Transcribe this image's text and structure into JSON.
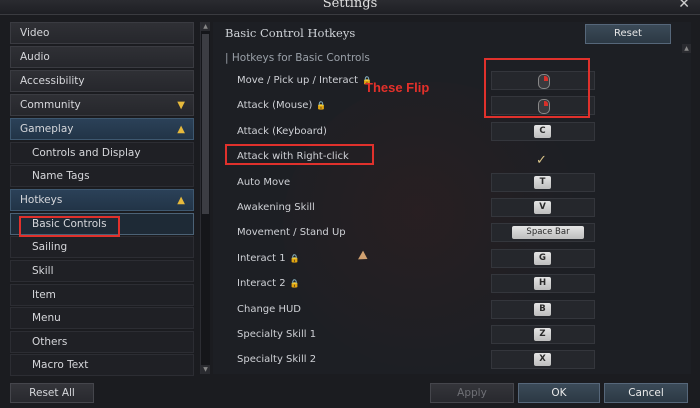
{
  "window": {
    "title": "Settings",
    "close_glyph": "✕"
  },
  "sidebar": {
    "items": [
      {
        "label": "Video"
      },
      {
        "label": "Audio"
      },
      {
        "label": "Accessibility"
      },
      {
        "label": "Community"
      },
      {
        "label": "Gameplay"
      },
      {
        "label": "Controls and Display"
      },
      {
        "label": "Name Tags"
      },
      {
        "label": "Hotkeys"
      },
      {
        "label": "Basic Controls"
      },
      {
        "label": "Sailing"
      },
      {
        "label": "Skill"
      },
      {
        "label": "Item"
      },
      {
        "label": "Menu"
      },
      {
        "label": "Others"
      },
      {
        "label": "Macro Text"
      }
    ],
    "selected": "Basic Controls"
  },
  "panel": {
    "title": "Basic Control Hotkeys",
    "reset_label": "Reset",
    "section_title": "| Hotkeys for Basic Controls",
    "rows": [
      {
        "label": "Move / Pick up / Interact",
        "locked": true,
        "key": "mouse-right-icon"
      },
      {
        "label": "Attack (Mouse)",
        "locked": true,
        "key": "mouse-right-icon"
      },
      {
        "label": "Attack (Keyboard)",
        "locked": false,
        "key": "C"
      },
      {
        "label": "Attack with Right-click",
        "locked": false,
        "key": "✓"
      },
      {
        "label": "Auto Move",
        "locked": false,
        "key": "T"
      },
      {
        "label": "Awakening Skill",
        "locked": false,
        "key": "V"
      },
      {
        "label": "Movement / Stand Up",
        "locked": false,
        "key": "Space Bar"
      },
      {
        "label": "Interact 1",
        "locked": true,
        "key": "G"
      },
      {
        "label": "Interact 2",
        "locked": true,
        "key": "H"
      },
      {
        "label": "Change HUD",
        "locked": false,
        "key": "B"
      },
      {
        "label": "Specialty Skill 1",
        "locked": false,
        "key": "Z"
      },
      {
        "label": "Specialty Skill 2",
        "locked": false,
        "key": "X"
      }
    ],
    "annotation": "These Flip"
  },
  "footer": {
    "reset_all_label": "Reset All",
    "apply_label": "Apply",
    "ok_label": "OK",
    "cancel_label": "Cancel"
  },
  "colors": {
    "accent_red": "#e0312c",
    "chevron_gold": "#e6b93c"
  }
}
